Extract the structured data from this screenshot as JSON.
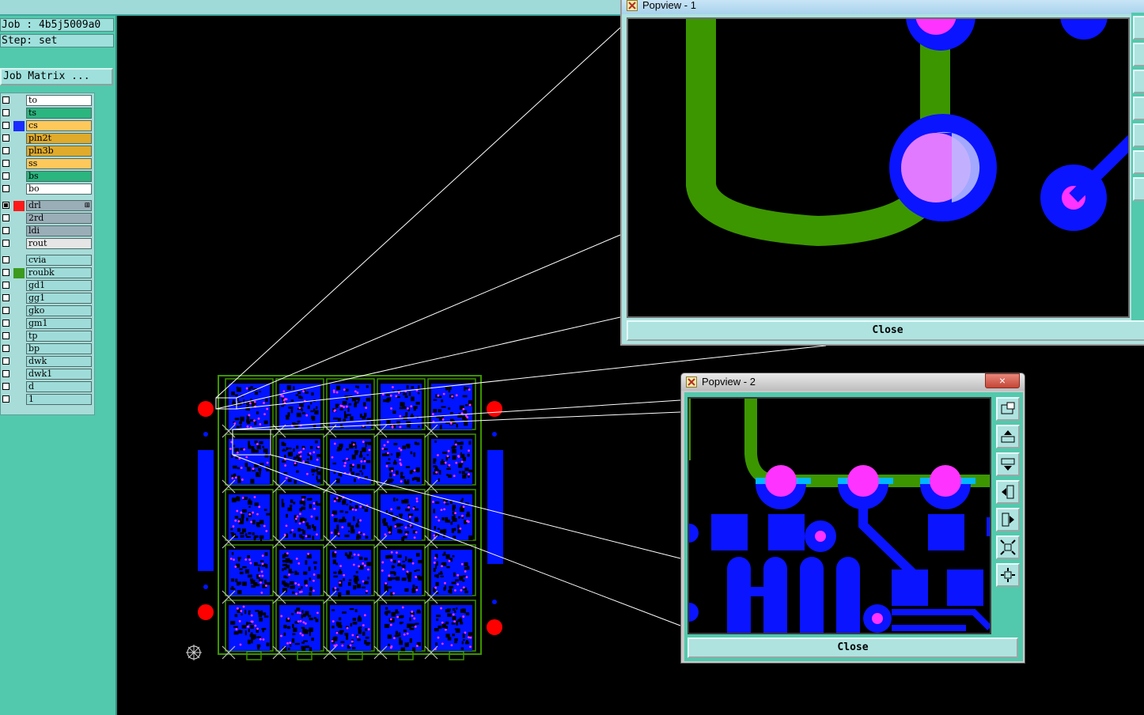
{
  "job": {
    "job_label": "Job : 4b5j5009a0",
    "step_label": "Step: set",
    "matrix_button": "Job Matrix ..."
  },
  "colors": {
    "panel": "#52c9ac",
    "board_layer": "#0014ff",
    "pad": "#ff33ff",
    "drill": "#ff0000",
    "route": "#3c9600"
  },
  "layers": [
    {
      "name": "to",
      "row_color": "#ffffff",
      "swatch": "",
      "checked": false
    },
    {
      "name": "ts",
      "row_color": "#2bb57f",
      "swatch": "",
      "checked": false
    },
    {
      "name": "cs",
      "row_color": "#ffc85a",
      "swatch": "#1a2cff",
      "checked": false
    },
    {
      "name": "pln2t",
      "row_color": "#e0aa2a",
      "swatch": "",
      "checked": false
    },
    {
      "name": "pln3b",
      "row_color": "#e0aa2a",
      "swatch": "",
      "checked": false
    },
    {
      "name": "ss",
      "row_color": "#ffc85a",
      "swatch": "",
      "checked": false
    },
    {
      "name": "bs",
      "row_color": "#2bb57f",
      "swatch": "",
      "checked": false
    },
    {
      "name": "bo",
      "row_color": "#ffffff",
      "swatch": "",
      "checked": false
    },
    {
      "name": "drl",
      "row_color": "#9aaeb8",
      "swatch": "#ff1a1a",
      "checked": true,
      "has_menu": true
    },
    {
      "name": "2rd",
      "row_color": "#9aaeb8",
      "swatch": "",
      "checked": false
    },
    {
      "name": "ldi",
      "row_color": "#9aaeb8",
      "swatch": "",
      "checked": false
    },
    {
      "name": "rout",
      "row_color": "#e6e6e6",
      "swatch": "",
      "checked": false
    },
    {
      "name": "cvia",
      "row_color": "#9fdcd9",
      "swatch": "",
      "checked": false
    },
    {
      "name": "roubk",
      "row_color": "#9fdcd9",
      "swatch": "#3c9a1e",
      "checked": false
    },
    {
      "name": "gd1",
      "row_color": "#9fdcd9",
      "swatch": "",
      "checked": false
    },
    {
      "name": "gg1",
      "row_color": "#9fdcd9",
      "swatch": "",
      "checked": false
    },
    {
      "name": "gko",
      "row_color": "#9fdcd9",
      "swatch": "",
      "checked": false
    },
    {
      "name": "gm1",
      "row_color": "#9fdcd9",
      "swatch": "",
      "checked": false
    },
    {
      "name": "tp",
      "row_color": "#9fdcd9",
      "swatch": "",
      "checked": false
    },
    {
      "name": "bp",
      "row_color": "#9fdcd9",
      "swatch": "",
      "checked": false
    },
    {
      "name": "dwk",
      "row_color": "#9fdcd9",
      "swatch": "",
      "checked": false
    },
    {
      "name": "dwk1",
      "row_color": "#9fdcd9",
      "swatch": "",
      "checked": false
    },
    {
      "name": "d",
      "row_color": "#9fdcd9",
      "swatch": "",
      "checked": false
    },
    {
      "name": "1",
      "row_color": "#9fdcd9",
      "swatch": "",
      "checked": false
    }
  ],
  "popview1": {
    "title": "Popview - 1",
    "close_label": "Close"
  },
  "popview2": {
    "title": "Popview - 2",
    "close_label": "Close",
    "close_x": "×"
  },
  "toolbar_icons": [
    "zoom-fit-icon",
    "pan-up-icon",
    "pan-down-icon",
    "pan-left-icon",
    "pan-right-icon",
    "zoom-out-icon",
    "zoom-in-icon"
  ]
}
